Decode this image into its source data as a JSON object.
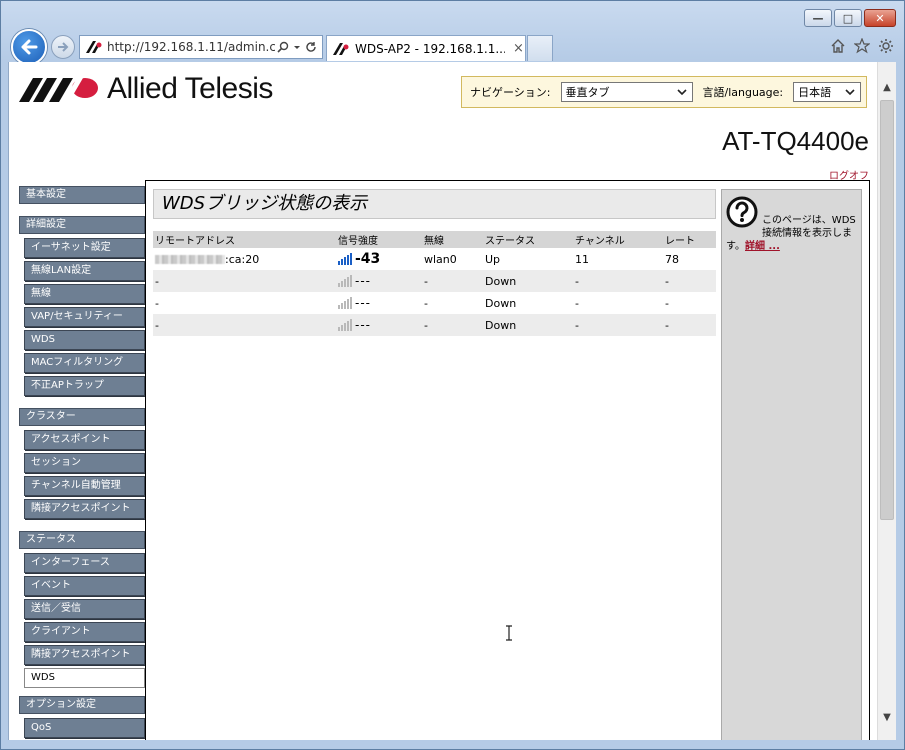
{
  "browser": {
    "url": "http://192.168.1.11/admin.c",
    "tab_title": "WDS-AP2 - 192.168.1.1...",
    "tab_close": "×"
  },
  "header": {
    "brand": "Allied Telesis",
    "nav_label": "ナビゲーション:",
    "nav_value": "垂直タブ",
    "lang_label": "言語/language:",
    "lang_value": "日本語",
    "model": "AT-TQ4400e",
    "logoff": "ログオフ"
  },
  "sidebar": {
    "basic": "基本設定",
    "advanced": "詳細設定",
    "advanced_items": [
      "イーサネット設定",
      "無線LAN設定",
      "無線",
      "VAP/セキュリティー",
      "WDS",
      "MACフィルタリング",
      "不正APトラップ"
    ],
    "cluster": "クラスター",
    "cluster_items": [
      "アクセスポイント",
      "セッション",
      "チャンネル自動管理",
      "隣接アクセスポイント"
    ],
    "status": "ステータス",
    "status_items": [
      "インターフェース",
      "イベント",
      "送信／受信",
      "クライアント",
      "隣接アクセスポイント",
      "WDS"
    ],
    "options": "オプション設定",
    "options_items": [
      "QoS"
    ]
  },
  "main": {
    "title": "WDSブリッジ状態の表示",
    "columns": [
      "リモートアドレス",
      "信号強度",
      "無線",
      "ステータス",
      "チャンネル",
      "レート"
    ],
    "rows": [
      {
        "address": ":ca:20",
        "signal": "-43",
        "radio": "wlan0",
        "status": "Up",
        "channel": "11",
        "rate": "78"
      },
      {
        "address": "-",
        "signal": "---",
        "radio": "-",
        "status": "Down",
        "channel": "-",
        "rate": "-"
      },
      {
        "address": "-",
        "signal": "---",
        "radio": "-",
        "status": "Down",
        "channel": "-",
        "rate": "-"
      },
      {
        "address": "-",
        "signal": "---",
        "radio": "-",
        "status": "Down",
        "channel": "-",
        "rate": "-"
      }
    ]
  },
  "help": {
    "text": "このページは、WDS接続情報を表示します。",
    "more": "詳細 ..."
  },
  "colors": {
    "sidebar": "#6e7f93",
    "link": "#a0132a",
    "signal_on": "#1a5fc6"
  }
}
